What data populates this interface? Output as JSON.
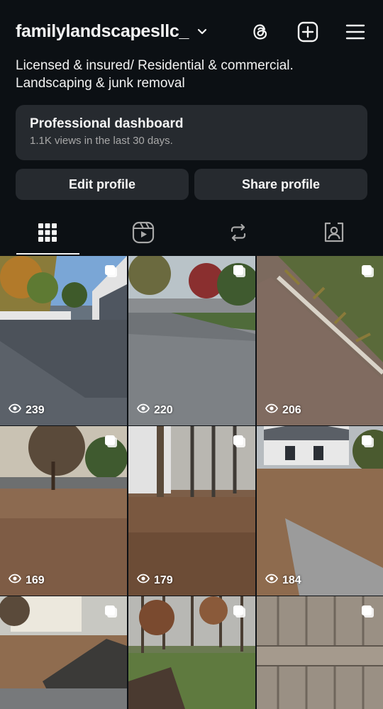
{
  "header": {
    "username": "familylandscapesllc_",
    "icons": [
      "chevron-down-icon",
      "threads-icon",
      "new-post-icon",
      "menu-icon"
    ]
  },
  "bio": {
    "lines": [
      "Licensed & insured/ Residential & commercial.",
      "Landscaping & junk removal"
    ]
  },
  "dashboard": {
    "title": "Professional dashboard",
    "subtitle": "1.1K views in the last 30 days."
  },
  "buttons": {
    "edit": "Edit profile",
    "share": "Share profile"
  },
  "tabs": [
    {
      "icon": "grid-icon",
      "selected": true
    },
    {
      "icon": "reels-icon",
      "selected": false
    },
    {
      "icon": "reposts-icon",
      "selected": false
    },
    {
      "icon": "tagged-icon",
      "selected": false
    }
  ],
  "posts": [
    {
      "views": "239"
    },
    {
      "views": "220"
    },
    {
      "views": "206"
    },
    {
      "views": "169"
    },
    {
      "views": "179"
    },
    {
      "views": "184"
    },
    {
      "views": ""
    },
    {
      "views": ""
    },
    {
      "views": ""
    }
  ],
  "colors": {
    "background": "#0c1014",
    "surface": "#262a2f",
    "text": "#f5f5f5",
    "muted": "#a8a8a8"
  }
}
